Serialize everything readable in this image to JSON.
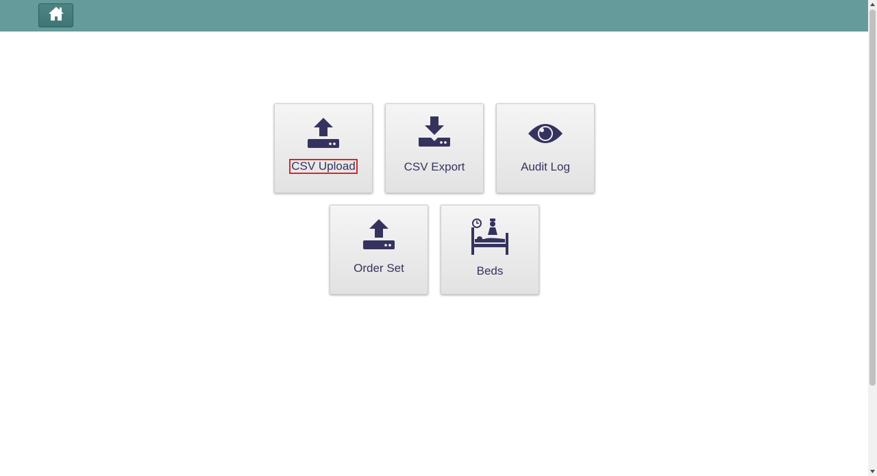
{
  "header": {
    "home_icon": "home-icon",
    "bar_color": "#659b9a"
  },
  "tiles": [
    {
      "label": "CSV Upload",
      "icon": "upload-tray-icon"
    },
    {
      "label": "CSV Export",
      "icon": "download-tray-icon"
    },
    {
      "label": "Audit Log",
      "icon": "eye-icon"
    },
    {
      "label": "Order Set",
      "icon": "upload-tray-icon"
    },
    {
      "label": "Beds",
      "icon": "hospital-bed-icon"
    }
  ],
  "colors": {
    "icon": "#35335e",
    "highlight": "#d62828"
  }
}
